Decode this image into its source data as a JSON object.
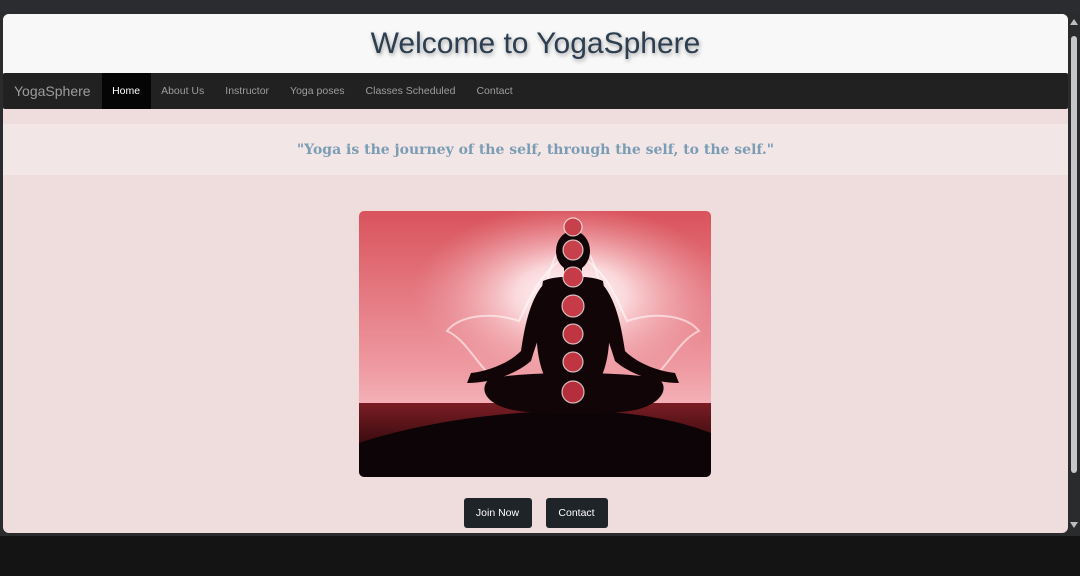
{
  "header": {
    "title": "Welcome to YogaSphere"
  },
  "navbar": {
    "brand": "YogaSphere",
    "items": [
      {
        "label": "Home",
        "active": true
      },
      {
        "label": "About Us",
        "active": false
      },
      {
        "label": "Instructor",
        "active": false
      },
      {
        "label": "Yoga poses",
        "active": false
      },
      {
        "label": "Classes Scheduled",
        "active": false
      },
      {
        "label": "Contact",
        "active": false
      }
    ]
  },
  "quote": {
    "text": "\"Yoga is the journey of the self, through the self, to the self.\""
  },
  "hero": {
    "image": "meditation-chakra-silhouette"
  },
  "buttons": {
    "join_label": "Join Now",
    "contact_label": "Contact"
  },
  "colors": {
    "page_background": "#efdcdc",
    "header_background": "#f8f8f8",
    "title_color": "#2c3e50",
    "navbar_background": "#212121",
    "nav_active_background": "#050505",
    "quote_band_background": "#f3e6e7",
    "quote_color": "#7a9db4",
    "button_background": "#1f2428"
  }
}
